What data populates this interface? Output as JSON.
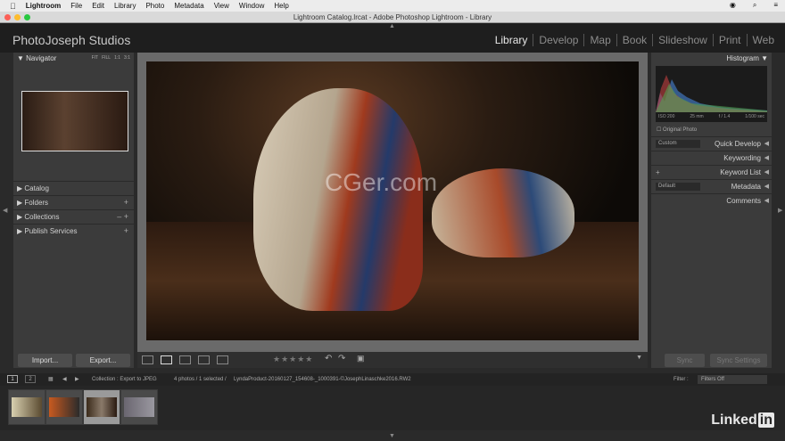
{
  "menubar": {
    "items": [
      "Lightroom",
      "File",
      "Edit",
      "Library",
      "Photo",
      "Metadata",
      "View",
      "Window",
      "Help"
    ]
  },
  "window": {
    "title": "Lightroom Catalog.lrcat - Adobe Photoshop Lightroom - Library"
  },
  "identity_plate": "PhotoJoseph Studios",
  "modules": [
    "Library",
    "Develop",
    "Map",
    "Book",
    "Slideshow",
    "Print",
    "Web"
  ],
  "left_panel": {
    "navigator": {
      "label": "Navigator",
      "options": [
        "FIT",
        "FILL",
        "1:1",
        "3:1"
      ]
    },
    "sections": [
      {
        "label": "Catalog",
        "plus": ""
      },
      {
        "label": "Folders",
        "plus": "+"
      },
      {
        "label": "Collections",
        "plus": "– +"
      },
      {
        "label": "Publish Services",
        "plus": "+"
      }
    ],
    "import_label": "Import...",
    "export_label": "Export..."
  },
  "watermark": "CGer.com",
  "right_panel": {
    "histogram_label": "Histogram",
    "histogram_info": [
      "ISO 200",
      "25 mm",
      "f / 1.4",
      "1/100 sec"
    ],
    "original_photo": "Original Photo",
    "sections": [
      {
        "label": "Quick Develop",
        "dropdown": "Custom"
      },
      {
        "label": "Keywording",
        "dropdown": ""
      },
      {
        "label": "Keyword List",
        "dropdown": "+"
      },
      {
        "label": "Metadata",
        "dropdown": "Default"
      },
      {
        "label": "Comments",
        "dropdown": ""
      }
    ],
    "sync_label": "Sync",
    "sync_settings_label": "Sync Settings"
  },
  "filmstrip_bar": {
    "pages": [
      "1",
      "2"
    ],
    "source": "Collection : Export to JPEG",
    "count": "4 photos / 1 selected /",
    "filename": "LyndaProduct-20160127_154608-_1000391-©JosephLinaschke2016.RW2",
    "filter_label": "Filter :",
    "filter_value": "Filters Off"
  },
  "brand": {
    "name": "Linked",
    "in": "in"
  },
  "colors": {
    "accent": "#e8e8e8",
    "panel": "#3b3b3b"
  }
}
